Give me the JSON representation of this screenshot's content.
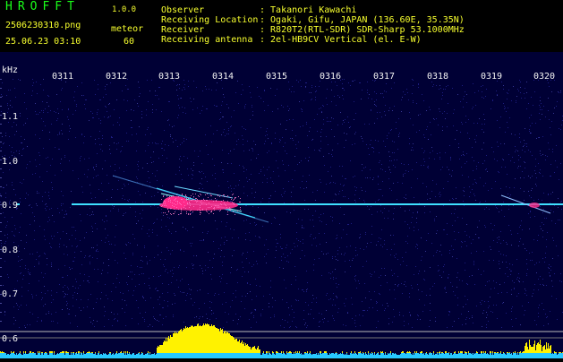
{
  "header": {
    "app_name": "HROFFT",
    "app_version": "1.0.0",
    "filename": "2506230310.png",
    "timestamp": "25.06.23 03:10",
    "meteor_label": "meteor",
    "meteor_count": "60",
    "info_labels": [
      "Observer",
      "Receiving Location",
      "Receiver",
      "Receiving antenna"
    ],
    "info_values": [
      ": Takanori Kawachi",
      ": Ogaki, Gifu, JAPAN (136.60E, 35.35N)",
      ": R820T2(RTL-SDR) SDR-Sharp 53.1000MHz",
      ": 2el-HB9CV Vertical (el. E-W)"
    ]
  },
  "spectrogram": {
    "y_unit": "kHz",
    "y_ticks": [
      "1.1",
      "1.0",
      "0.9",
      "0.8",
      "0.7",
      "0.6"
    ],
    "x_ticks": [
      "0311",
      "0312",
      "0313",
      "0314",
      "0315",
      "0316",
      "0317",
      "0318",
      "0319",
      "0320"
    ],
    "carrier_khz": 0.9,
    "colors": {
      "background": "#000035",
      "carrier": "#3fe0ff",
      "echo": "#ff2a8a",
      "noise": "#2a2aa0",
      "activity": "#fff200",
      "baseline": "#28c9ff"
    }
  }
}
